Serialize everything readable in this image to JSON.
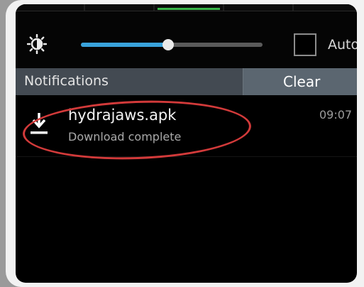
{
  "quick_settings": {
    "brightness": {
      "level": 0.48,
      "auto_label": "Auto",
      "auto_checked": false
    }
  },
  "notifications": {
    "header_label": "Notifications",
    "clear_label": "Clear",
    "items": [
      {
        "title": "hydrajaws.apk",
        "subtitle": "Download complete",
        "time": "09:07",
        "icon": "download-icon"
      }
    ]
  },
  "colors": {
    "accent": "#39a3dc",
    "header_bg": "#434a52",
    "clear_bg": "#5b6670",
    "highlight": "#d23a3a",
    "active_toggle": "#39b54a"
  }
}
